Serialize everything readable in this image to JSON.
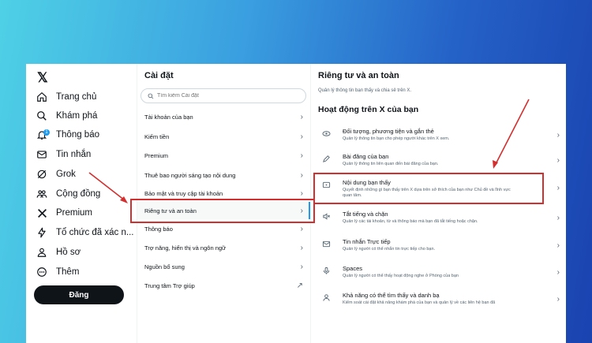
{
  "app": {
    "logo": "𝕏"
  },
  "nav": {
    "items": [
      {
        "label": "Trang chủ",
        "icon": "home-icon"
      },
      {
        "label": "Khám phá",
        "icon": "search-icon"
      },
      {
        "label": "Thông báo",
        "icon": "bell-icon",
        "badge": "1"
      },
      {
        "label": "Tin nhắn",
        "icon": "mail-icon"
      },
      {
        "label": "Grok",
        "icon": "grok-icon"
      },
      {
        "label": "Cộng đồng",
        "icon": "community-icon"
      },
      {
        "label": "Premium",
        "icon": "x-icon"
      },
      {
        "label": "Tổ chức đã xác n...",
        "icon": "lightning-icon"
      },
      {
        "label": "Hồ sơ",
        "icon": "profile-icon"
      },
      {
        "label": "Thêm",
        "icon": "more-icon"
      }
    ],
    "post_label": "Đăng"
  },
  "settings": {
    "title": "Cài đặt",
    "search_placeholder": "Tìm kiếm Cài đặt",
    "items": [
      {
        "label": "Tài khoản của bạn",
        "arrow": "›"
      },
      {
        "label": "Kiếm tiền",
        "arrow": "›"
      },
      {
        "label": "Premium",
        "arrow": "›"
      },
      {
        "label": "Thuê bao người sáng tạo nội dung",
        "arrow": "›"
      },
      {
        "label": "Bảo mật và truy cập tài khoản",
        "arrow": "›"
      },
      {
        "label": "Riêng tư và an toàn",
        "arrow": "›",
        "active": true
      },
      {
        "label": "Thông báo",
        "arrow": "›"
      },
      {
        "label": "Trợ năng, hiển thị và ngôn ngữ",
        "arrow": "›"
      },
      {
        "label": "Nguồn bổ sung",
        "arrow": "›"
      },
      {
        "label": "Trung tâm Trợ giúp",
        "arrow": "↗"
      }
    ]
  },
  "privacy": {
    "title": "Riêng tư và an toàn",
    "description": "Quản lý thông tin bạn thấy và chia sẻ trên X.",
    "section_title": "Hoạt động trên X của bạn",
    "items": [
      {
        "title": "Đối tượng, phương tiện và gắn thẻ",
        "subtitle": "Quản lý thông tin bạn cho phép người khác trên X xem.",
        "icon": "audience-icon"
      },
      {
        "title": "Bài đăng của bạn",
        "subtitle": "Quản lý thông tin liên quan đến bài đăng của bạn.",
        "icon": "edit-icon"
      },
      {
        "title": "Nội dung bạn thấy",
        "subtitle": "Quyết định những gì bạn thấy trên X dựa trên sở thích của bạn như Chủ đề và lĩnh vực quan tâm.",
        "icon": "content-icon"
      },
      {
        "title": "Tắt tiếng và chặn",
        "subtitle": "Quản lý các tài khoản, từ và thông báo mà bạn đã tắt tiếng hoặc chặn.",
        "icon": "mute-icon"
      },
      {
        "title": "Tin nhắn Trực tiếp",
        "subtitle": "Quản lý người có thể nhắn tin trực tiếp cho bạn.",
        "icon": "mail-icon"
      },
      {
        "title": "Spaces",
        "subtitle": "Quản lý người có thể thấy hoạt động nghe ở Phòng của bạn",
        "icon": "spaces-icon"
      },
      {
        "title": "Khả năng có thể tìm thấy và danh bạ",
        "subtitle": "Kiểm soát cài đặt khả năng khám phá của bạn và quản lý về các liên hệ bạn đã",
        "icon": "contacts-icon"
      }
    ],
    "arrow": "›"
  },
  "colors": {
    "highlight": "#d32f2f",
    "accent": "#1d9bf0",
    "text": "#0f1419",
    "muted": "#536471"
  }
}
